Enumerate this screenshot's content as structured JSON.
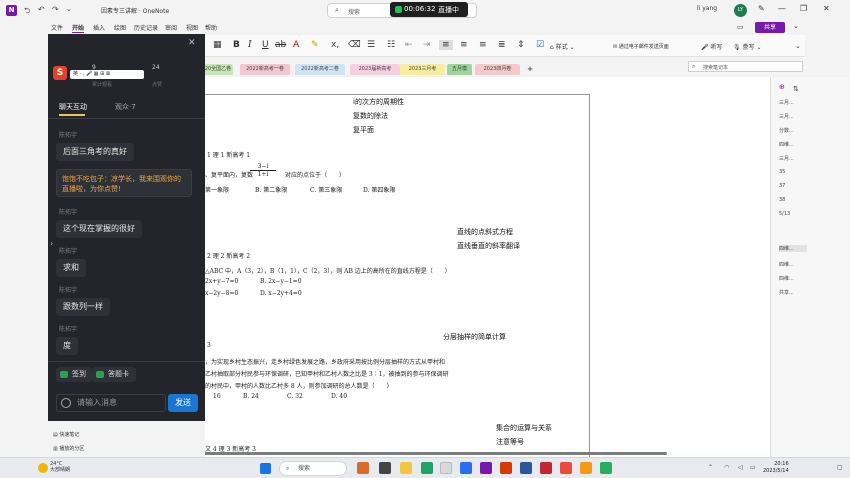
{
  "titlebar": {
    "document_title": "因素专三讲解 · OneNote",
    "search_placeholder": "搜索",
    "recording_time": "00:06:32",
    "live_label": "直播中",
    "user_name": "li yang",
    "user_initials": "LY"
  },
  "menu": {
    "items": [
      "文件",
      "开始",
      "插入",
      "绘图",
      "历史记录",
      "审阅",
      "视图",
      "帮助"
    ],
    "active": "开始",
    "share_label": "共享"
  },
  "ribbon": {
    "style_label": "样式",
    "email_label": "通过电子邮件发送页面",
    "dictate_label": "听写",
    "reader_label": "誊写"
  },
  "section_tabs": [
    {
      "label": "20全国乙卷",
      "color": "#c7e6b3"
    },
    {
      "label": "2022新高考一卷",
      "color": "#f3c6d2"
    },
    {
      "label": "2022新高考二卷",
      "color": "#cfe5f6"
    },
    {
      "label": "2023届新高考",
      "color": "#f6d0e0"
    },
    {
      "label": "2023三月考",
      "color": "#f8eca0"
    },
    {
      "label": "五月模",
      "color": "#9ed59a"
    },
    {
      "label": "2023四月卷",
      "color": "#f6c9c9"
    }
  ],
  "add_section_label": "+",
  "notebook_search_placeholder": "搜索笔记本",
  "canvas": {
    "handwritten_top": [
      "i的次方的周期性",
      "复数的除法",
      "复平面"
    ],
    "q1_header": "1 理 1 新高考 1",
    "q1_text": "、复平面内，复数",
    "q1_numerator": "3−i",
    "q1_denominator": "1+i",
    "q1_text2": "对应的点位于（　　）",
    "q1_options": [
      "第一象限",
      "B. 第二象限",
      "C. 第三象限",
      "D. 第四象限"
    ],
    "handwritten_mid": [
      "直线的点斜式方程",
      "直线垂直的斜率翻译"
    ],
    "q2_header": "2 理 2 新高考 2",
    "q2_text": "△ABC 中，A（3，2），B（1，1），C（2，3），则 AB 边上的高所在的直线方程是（　　）",
    "q2_options": [
      "2x+y−7=0",
      "B.  2x−y−1=0",
      "x−2y−8=0",
      "D.  x−2y+4=0"
    ],
    "handwritten_q3": "分层抽样的简单计算",
    "q3_header": "3",
    "q3_lines": [
      "，为实现乡村生态振兴，走乡村绿色发展之路，乡政府采用按比例分层抽样的方式从甲村和",
      "乙村抽取部分村民参与环保调研，已知甲村和乙村人数之比是 3∶1，被抽到的参与环保调研",
      "的村民中，甲村的人数比乙村多 8 人，则参加调研的总人数是（　　）"
    ],
    "q3_options": [
      "16",
      "B.  24",
      "C.  32",
      "D.  40"
    ],
    "handwritten_bottom": [
      "集合的运算与关系",
      "注意等号"
    ],
    "q4_header": "文 4 理 3 新高考 3"
  },
  "pages": [
    "三月...",
    "三月...",
    "分数...",
    "四维...",
    "三月...",
    "35",
    "37",
    "38",
    "5/13",
    "四维...",
    "四维...",
    "四维...",
    "共享..."
  ],
  "selected_page_index": 9,
  "left_bottom": [
    "快速笔记",
    "播放的分区"
  ],
  "chat": {
    "stat1_value": "9",
    "stat1_label": "累计观看",
    "stat2_value": "24",
    "stat2_label": "点赞",
    "logo_letter": "S",
    "logo_toolbar": "英 · , 🎤 ▦ ⊞ ⊠",
    "tab_chat": "聊天互动",
    "tab_viewers": "观众·7",
    "messages": [
      {
        "name": "陈拓宇",
        "text": "后面三角考的真好"
      },
      {
        "name": "陈拓宇",
        "text": "这个现在掌握的很好"
      },
      {
        "name": "陈拓宇",
        "text": "求和"
      },
      {
        "name": "陈拓宇",
        "text": "跟数列一样"
      },
      {
        "name": "陈拓宇",
        "text": "度"
      }
    ],
    "gift_text": "饱饱不吃包子：凉学长，我来围观你的直播啦，为你点赞!",
    "checkin_label": "签到",
    "answer_label": "答题卡",
    "input_placeholder": "请输入消息",
    "send_label": "发送"
  },
  "taskbar": {
    "temperature": "24°C",
    "weather": "大部晴朗",
    "search_placeholder": "搜索",
    "time": "20:16",
    "date": "2023/5/14"
  }
}
